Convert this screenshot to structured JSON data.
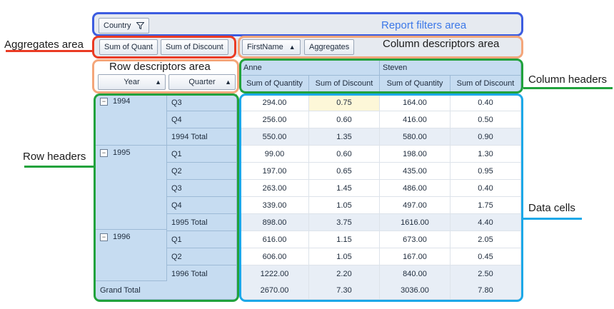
{
  "filters": {
    "country_label": "Country",
    "filter_icon": "funnel-icon",
    "area_label": "Report filters area"
  },
  "aggregates": {
    "items": [
      "Sum of Quant",
      "Sum of Discount"
    ],
    "area_label": "Aggregates area"
  },
  "column_descriptors": {
    "firstname_label": "FirstName",
    "aggregates_label": "Aggregates",
    "area_label": "Column descriptors area"
  },
  "row_descriptors": {
    "year_label": "Year",
    "quarter_label": "Quarter",
    "area_label": "Row descriptors area"
  },
  "column_headers": {
    "names": [
      "Anne",
      "Steven"
    ],
    "measures": [
      "Sum of Quantity",
      "Sum of Discount",
      "Sum of Quantity",
      "Sum of Discount"
    ],
    "area_label": "Column headers"
  },
  "row_headers_label": "Row headers",
  "data_cells_label": "Data cells",
  "rows": [
    {
      "year": "1994",
      "quarter": "Q3",
      "values": [
        "294.00",
        "0.75",
        "164.00",
        "0.40"
      ]
    },
    {
      "year": "",
      "quarter": "Q4",
      "values": [
        "256.00",
        "0.60",
        "416.00",
        "0.50"
      ]
    },
    {
      "year": "",
      "quarter": "1994 Total",
      "values": [
        "550.00",
        "1.35",
        "580.00",
        "0.90"
      ]
    },
    {
      "year": "1995",
      "quarter": "Q1",
      "values": [
        "99.00",
        "0.60",
        "198.00",
        "1.30"
      ]
    },
    {
      "year": "",
      "quarter": "Q2",
      "values": [
        "197.00",
        "0.65",
        "435.00",
        "0.95"
      ]
    },
    {
      "year": "",
      "quarter": "Q3",
      "values": [
        "263.00",
        "1.45",
        "486.00",
        "0.40"
      ]
    },
    {
      "year": "",
      "quarter": "Q4",
      "values": [
        "339.00",
        "1.05",
        "497.00",
        "1.75"
      ]
    },
    {
      "year": "",
      "quarter": "1995 Total",
      "values": [
        "898.00",
        "3.75",
        "1616.00",
        "4.40"
      ]
    },
    {
      "year": "1996",
      "quarter": "Q1",
      "values": [
        "616.00",
        "1.15",
        "673.00",
        "2.05"
      ]
    },
    {
      "year": "",
      "quarter": "Q2",
      "values": [
        "606.00",
        "1.05",
        "167.00",
        "0.45"
      ]
    },
    {
      "year": "",
      "quarter": "1996 Total",
      "values": [
        "1222.00",
        "2.20",
        "840.00",
        "2.50"
      ]
    }
  ],
  "grand_total": {
    "label": "Grand Total",
    "values": [
      "2670.00",
      "7.30",
      "3036.00",
      "7.80"
    ]
  },
  "colors": {
    "filters_frame": "#3c5ce0",
    "aggregates_frame": "#ea3b24",
    "descriptors_frame": "#f4a67a",
    "headers_frame": "#21a23c",
    "data_frame": "#1ca8e8",
    "header_bg": "#c6dcf1"
  }
}
